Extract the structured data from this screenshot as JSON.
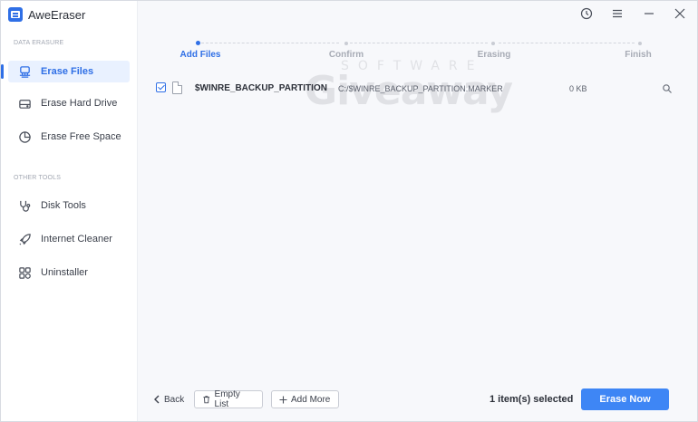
{
  "app": {
    "title": "AweEraser"
  },
  "colors": {
    "accent": "#2f6fe6",
    "primary_button": "#3e86f5",
    "sidebar_active_bg": "#e9f1ff"
  },
  "sidebar": {
    "section_data_erasure": "DATA ERASURE",
    "section_other_tools": "OTHER TOOLS",
    "items": [
      {
        "label": "Erase Files",
        "icon": "eraser-icon",
        "active": true
      },
      {
        "label": "Erase Hard Drive",
        "icon": "hard-drive-icon",
        "active": false
      },
      {
        "label": "Erase Free Space",
        "icon": "pie-chart-icon",
        "active": false
      },
      {
        "label": "Disk Tools",
        "icon": "stethoscope-icon",
        "active": false
      },
      {
        "label": "Internet Cleaner",
        "icon": "rocket-icon",
        "active": false
      },
      {
        "label": "Uninstaller",
        "icon": "grid-apps-icon",
        "active": false
      }
    ]
  },
  "titlebar": {
    "icons": [
      "history-icon",
      "menu-icon",
      "minimize-icon",
      "close-icon"
    ]
  },
  "steps": [
    {
      "label": "Add Files",
      "active": true
    },
    {
      "label": "Confirm",
      "active": false
    },
    {
      "label": "Erasing",
      "active": false
    },
    {
      "label": "Finish",
      "active": false
    }
  ],
  "files": [
    {
      "checked": true,
      "name": "$WINRE_BACKUP_PARTITION.MARKER",
      "path": "C:/$WINRE_BACKUP_PARTITION.MARKER",
      "size": "0 KB"
    }
  ],
  "watermark": {
    "top": "SOFTWARE",
    "main": "Giveaway"
  },
  "bottom": {
    "back_label": "Back",
    "empty_list_label": "Empty List",
    "add_more_label": "Add More",
    "selected_text": "1 item(s) selected",
    "erase_now_label": "Erase Now"
  }
}
